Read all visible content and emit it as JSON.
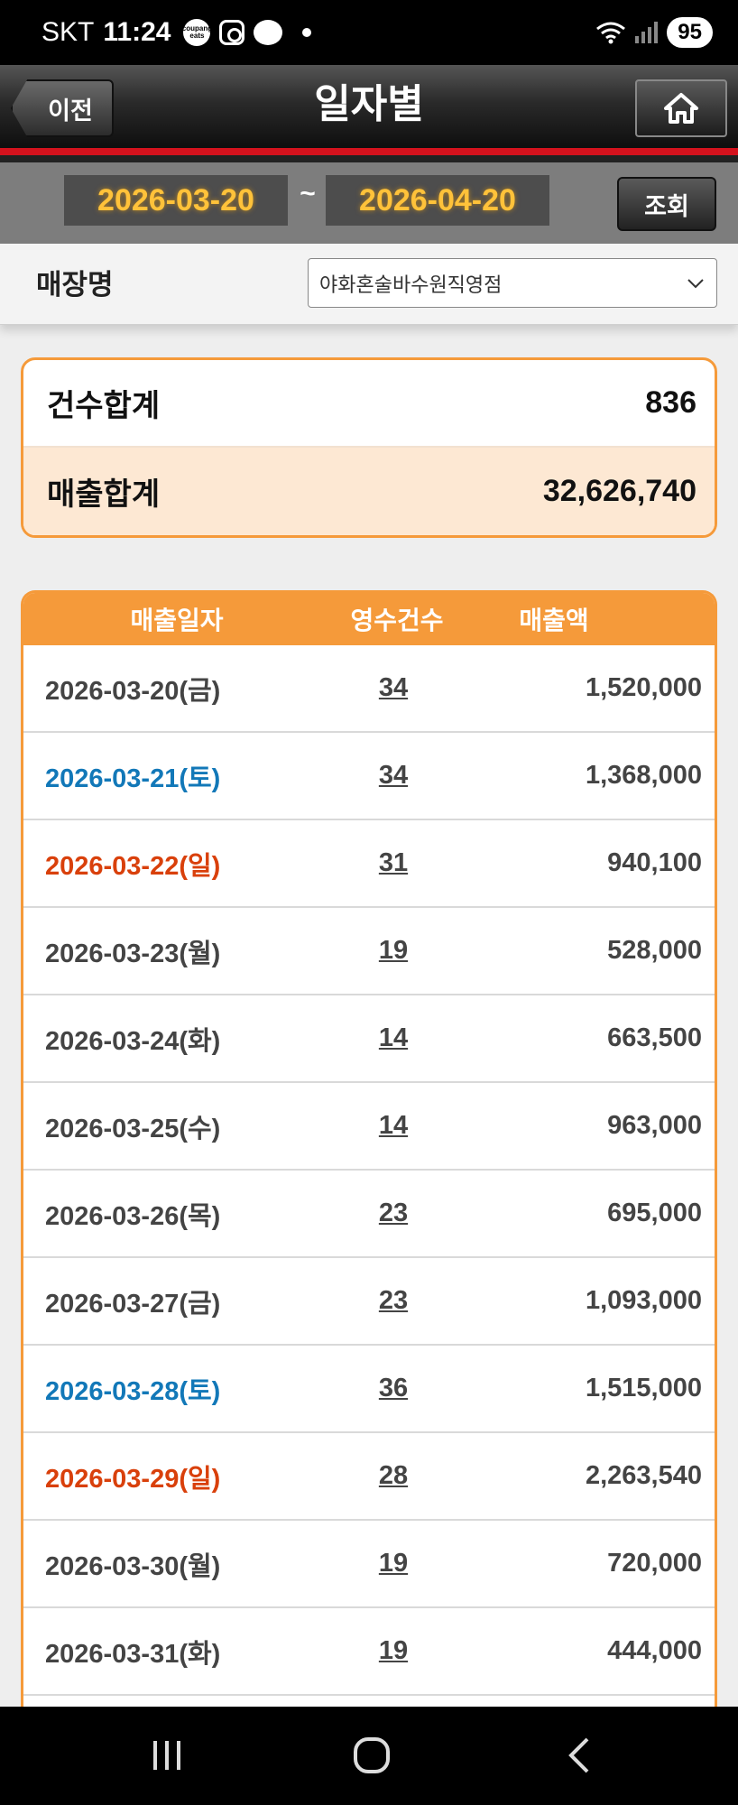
{
  "status_bar": {
    "carrier": "SKT",
    "time": "11:24",
    "app_icon_text": "coupang eats",
    "battery": "95"
  },
  "header": {
    "back_label": "이전",
    "title": "일자별"
  },
  "filter": {
    "start_date": "2026-03-20",
    "separator": "~",
    "end_date": "2026-04-20",
    "search_label": "조회"
  },
  "store": {
    "label": "매장명",
    "selected": "야화혼술바수원직영점"
  },
  "summary": {
    "count_label": "건수합계",
    "count_value": "836",
    "sales_label": "매출합계",
    "sales_value": "32,626,740"
  },
  "table": {
    "columns": [
      "매출일자",
      "영수건수",
      "매출액"
    ],
    "rows": [
      {
        "date": "2026-03-20(금)",
        "count": "34",
        "amount": "1,520,000",
        "day": "weekday"
      },
      {
        "date": "2026-03-21(토)",
        "count": "34",
        "amount": "1,368,000",
        "day": "sat"
      },
      {
        "date": "2026-03-22(일)",
        "count": "31",
        "amount": "940,100",
        "day": "sun"
      },
      {
        "date": "2026-03-23(월)",
        "count": "19",
        "amount": "528,000",
        "day": "weekday"
      },
      {
        "date": "2026-03-24(화)",
        "count": "14",
        "amount": "663,500",
        "day": "weekday"
      },
      {
        "date": "2026-03-25(수)",
        "count": "14",
        "amount": "963,000",
        "day": "weekday"
      },
      {
        "date": "2026-03-26(목)",
        "count": "23",
        "amount": "695,000",
        "day": "weekday"
      },
      {
        "date": "2026-03-27(금)",
        "count": "23",
        "amount": "1,093,000",
        "day": "weekday"
      },
      {
        "date": "2026-03-28(토)",
        "count": "36",
        "amount": "1,515,000",
        "day": "sat"
      },
      {
        "date": "2026-03-29(일)",
        "count": "28",
        "amount": "2,263,540",
        "day": "sun"
      },
      {
        "date": "2026-03-30(월)",
        "count": "19",
        "amount": "720,000",
        "day": "weekday"
      },
      {
        "date": "2026-03-31(화)",
        "count": "19",
        "amount": "444,000",
        "day": "weekday"
      }
    ]
  },
  "colors": {
    "accent_orange": "#f59a3a",
    "date_yellow": "#ffc23a",
    "saturday_blue": "#1278b8",
    "sunday_red": "#d9400b",
    "header_red_line": "#d4121d"
  },
  "icons": {
    "home": "home-icon",
    "dropdown": "chevron-down-icon",
    "nav_recents": "recent-apps-icon",
    "nav_home": "nav-home-icon",
    "nav_back": "nav-back-icon"
  }
}
